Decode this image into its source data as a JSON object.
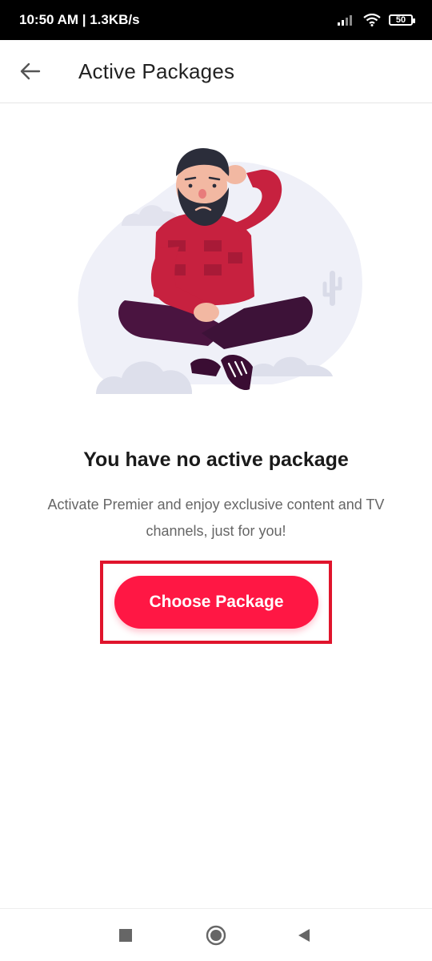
{
  "status_bar": {
    "time_speed": "10:50 AM | 1.3KB/s",
    "battery": "50",
    "icons": [
      "signal-icon",
      "wifi-icon",
      "battery-icon"
    ]
  },
  "app_bar": {
    "title": "Active Packages",
    "back_icon": "arrow-left-icon"
  },
  "empty_state": {
    "title": "You have no active package",
    "description": "Activate Premier and enjoy exclusive content and TV channels, just for you!",
    "button_label": "Choose Package",
    "illustration": "confused-man-illustration"
  },
  "colors": {
    "accent": "#ff1744",
    "highlight_frame": "#e0142c",
    "title_text": "#222222",
    "body_text": "#666666"
  },
  "nav_bar": {
    "icons": [
      "recent-apps-icon",
      "home-icon",
      "back-icon"
    ]
  }
}
